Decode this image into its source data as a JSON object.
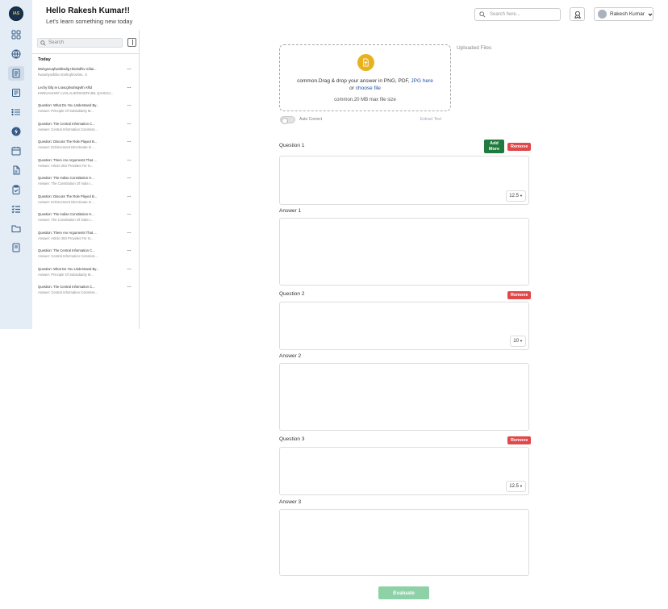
{
  "header": {
    "greeting": "Hello Rakesh Kumar!!",
    "subtitle": "Let's learn something new today"
  },
  "top_search": {
    "placeholder": "Search here..."
  },
  "user": {
    "name": "Rakesh Kumar"
  },
  "brand": {
    "logo_text": "IAS"
  },
  "history": {
    "search_placeholder": "Search",
    "group_label": "Today",
    "items": [
      {
        "q": "Wuhgoeuqfwahbsdig Hkiahdfsv Iciliai...",
        "a": "Kwuahyodbfuo Eiohrghiovhiei...h"
      },
      {
        "q": "Lechy Ibfq Ie Lrascghvahsgvkh Afkd",
        "a": "KWEUAUHDF LUVLALIERSHDFKJBL QAHESJ..."
      },
      {
        "q": "Question: What Do You Understand By...",
        "a": "Answer: Principle Of Subsidiarity M..."
      },
      {
        "q": "Question: The Central Information C...",
        "a": "Answer: Central Information Commiss..."
      },
      {
        "q": "Question: Discuss The Role Played B...",
        "a": "Answer: Enforcement Directorate Is ..."
      },
      {
        "q": "Question: There Are Arguments That ...",
        "a": "Answer: Article 263 Provides For In..."
      },
      {
        "q": "Question: The Indian Constitution H...",
        "a": "Answer: The Constitution Of India I..."
      },
      {
        "q": "Question: Discuss The Role Played B...",
        "a": "Answer: Enforcement Directorate Is ..."
      },
      {
        "q": "Question: The Indian Constitution H...",
        "a": "Answer: The Constitution Of India I..."
      },
      {
        "q": "Question: There Are Arguments That ...",
        "a": "Answer: Article 263 Provides For In..."
      },
      {
        "q": "Question: The Central Information C...",
        "a": "Answer: Central Information Commiss..."
      },
      {
        "q": "Question: What Do You Understand By...",
        "a": "Answer: Principle Of Subsidiarity M..."
      },
      {
        "q": "Question: The Central Information C...",
        "a": "Answer: Central Information Commiss..."
      }
    ],
    "more_glyph": "···"
  },
  "upload": {
    "line1_a": "common.Drag & drop your answer in PNG, PDF, ",
    "line1_link": "JPG here",
    "line2_a": "or ",
    "line2_link": "choose file",
    "limit": "common.20 MB max file size",
    "uploaded_files": "Uploaded Files"
  },
  "options": {
    "auto_correct": "Auto Correct",
    "extract_text": "Extract Text"
  },
  "buttons": {
    "add_more": "Add More",
    "remove": "Remove",
    "evaluate": "Evaluate"
  },
  "blocks": [
    {
      "q_label": "Question 1",
      "a_label": "Answer 1",
      "size": "12.5"
    },
    {
      "q_label": "Question 2",
      "a_label": "Answer 2",
      "size": "10"
    },
    {
      "q_label": "Question 3",
      "a_label": "Answer 3",
      "size": "12.5"
    }
  ],
  "colors": {
    "rail": "#e4ecf5",
    "remove": "#e0484a",
    "add_more": "#1e7a3d",
    "evaluate": "#8ed1a7",
    "link": "#1f4fa3"
  }
}
